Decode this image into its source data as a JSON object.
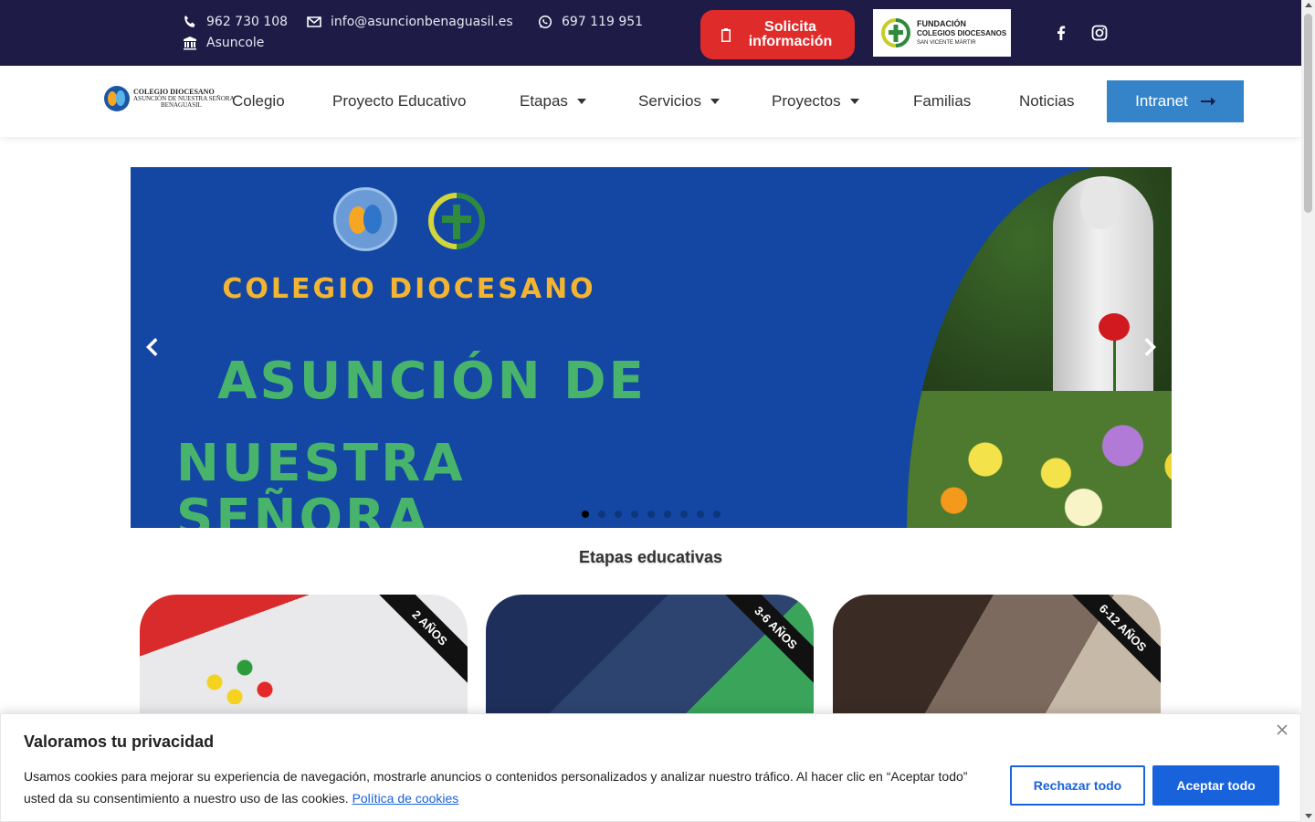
{
  "topbar": {
    "phone": "962 730 108",
    "email": "info@asuncionbenaguasil.es",
    "whatsapp": "697 119 951",
    "school_short": "Asuncole",
    "cta_label": "Solicita información",
    "fundacion_line1": "FUNDACIÓN",
    "fundacion_line2": "COLEGIOS DIOCESANOS",
    "fundacion_line3": "SAN VICENTE MÁRTIR",
    "icons": [
      "phone-icon",
      "envelope-icon",
      "whatsapp-icon",
      "school-icon",
      "clipboard-icon",
      "facebook-icon",
      "instagram-icon"
    ],
    "colors": {
      "background": "#1e1b47",
      "cta": "#e02b2b"
    }
  },
  "nav": {
    "logo_line1": "COLEGIO DIOCESANO",
    "logo_line2": "ASUNCIÓN DE NUESTRA SEÑORA",
    "logo_line3": "BENAGUASIL",
    "items": [
      {
        "label": "Colegio",
        "dropdown": false
      },
      {
        "label": "Proyecto Educativo",
        "dropdown": false
      },
      {
        "label": "Etapas",
        "dropdown": true
      },
      {
        "label": "Servicios",
        "dropdown": true
      },
      {
        "label": "Proyectos",
        "dropdown": true
      },
      {
        "label": "Familias",
        "dropdown": false
      },
      {
        "label": "Noticias",
        "dropdown": false
      }
    ],
    "intranet_label": "Intranet",
    "colors": {
      "intranet": "#3584c9"
    }
  },
  "slider": {
    "line1": "COLEGIO DIOCESANO",
    "line2": "ASUNCIÓN DE",
    "line3": "NUESTRA SEÑORA",
    "total_slides": 9,
    "active_slide": 1,
    "colors": {
      "background": "#1447a3",
      "title": "#f3b431",
      "subtitle": "#48b46b"
    }
  },
  "stages": {
    "title": "Etapas educativas",
    "cards": [
      {
        "ribbon": "2 AÑOS"
      },
      {
        "ribbon": "3-6 AÑOS"
      },
      {
        "ribbon": "6-12 AÑOS"
      }
    ]
  },
  "cookie": {
    "title": "Valoramos tu privacidad",
    "text": "Usamos cookies para mejorar su experiencia de navegación, mostrarle anuncios o contenidos personalizados y analizar nuestro tráfico. Al hacer clic en “Aceptar todo” usted da su consentimiento a nuestro uso de las cookies.",
    "link": "Política de cookies",
    "reject_label": "Rechazar todo",
    "accept_label": "Aceptar todo",
    "colors": {
      "primary": "#1863dc"
    }
  }
}
